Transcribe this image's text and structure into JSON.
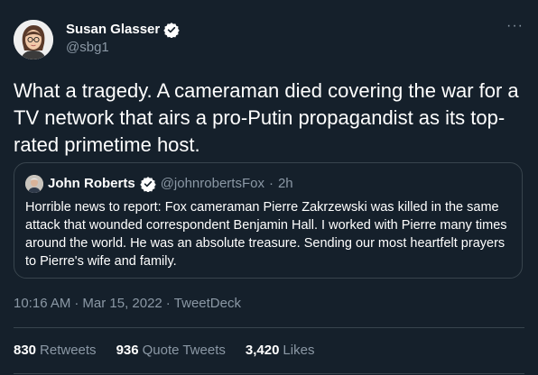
{
  "author": {
    "name": "Susan Glasser",
    "handle": "@sbg1",
    "verified_color": "#1d9bf0"
  },
  "tweet": {
    "text": "What a tragedy. A cameraman died covering the war for a TV network that airs a pro-Putin propagandist as its top-rated primetime host."
  },
  "quoted": {
    "name": "John Roberts",
    "handle": "@johnrobertsFox",
    "time": "2h",
    "text": "Horrible news to report: Fox cameraman Pierre Zakrzewski was killed in the same attack that wounded correspondent Benjamin Hall. I worked with Pierre many times around the world. He was an absolute treasure. Sending our most heartfelt prayers to Pierre's wife and family."
  },
  "meta": {
    "time": "10:16 AM",
    "date": "Mar 15, 2022",
    "source": "TweetDeck"
  },
  "stats": {
    "retweets_count": "830",
    "retweets_label": "Retweets",
    "quotes_count": "936",
    "quotes_label": "Quote Tweets",
    "likes_count": "3,420",
    "likes_label": "Likes"
  },
  "more_glyph": "···",
  "theme": {
    "background": "#15202b",
    "secondary_text": "#8b98a5",
    "border": "#38444d"
  }
}
